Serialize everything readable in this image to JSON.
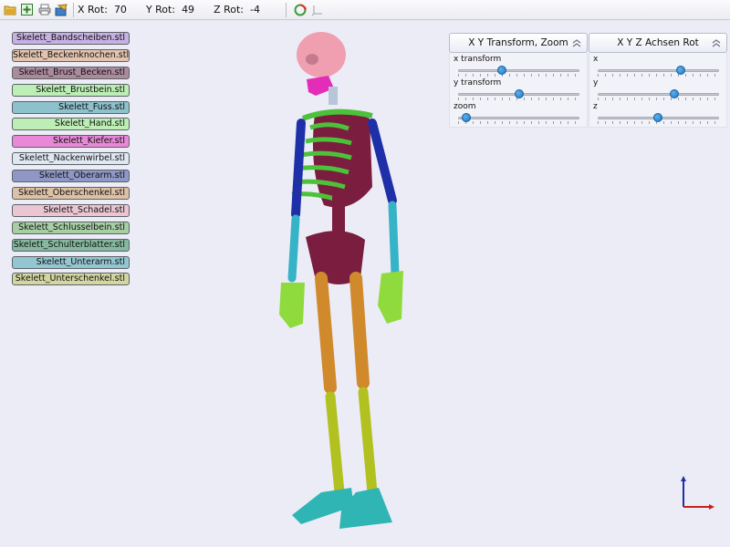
{
  "toolbar": {
    "icons": [
      "open-folder-icon",
      "add-model-icon",
      "print-icon",
      "export-icon",
      "reset-view-icon",
      "axis-icon"
    ],
    "x_rot_label": "X Rot:",
    "x_rot_value": "70",
    "y_rot_label": "Y Rot:",
    "y_rot_value": "49",
    "z_rot_label": "Z Rot:",
    "z_rot_value": "-4"
  },
  "files": [
    {
      "label": "Skelett_Bandscheiben.stl",
      "color": "#c7b0e2"
    },
    {
      "label": "Skelett_Beckenknochen.stl",
      "color": "#e3c3ae"
    },
    {
      "label": "Skelett_Brust_Becken.stl",
      "color": "#ab8a9c"
    },
    {
      "label": "Skelett_Brustbein.stl",
      "color": "#bdeeb5"
    },
    {
      "label": "Skelett_Fuss.stl",
      "color": "#8dc1cb"
    },
    {
      "label": "Skelett_Hand.stl",
      "color": "#bdeeb5"
    },
    {
      "label": "Skelett_Kiefer.stl",
      "color": "#e888d7"
    },
    {
      "label": "Skelett_Nackenwirbel.stl",
      "color": "#dfe7f1"
    },
    {
      "label": "Skelett_Oberarm.stl",
      "color": "#8e97c5"
    },
    {
      "label": "Skelett_Oberschenkel.stl",
      "color": "#ddc1a6"
    },
    {
      "label": "Skelett_Schadel.stl",
      "color": "#ecc5d3"
    },
    {
      "label": "Skelett_Schlusselbein.stl",
      "color": "#a7cfa4"
    },
    {
      "label": "Skelett_Schulterblatter.stl",
      "color": "#86b8a0"
    },
    {
      "label": "Skelett_Unterarm.stl",
      "color": "#94c6d1"
    },
    {
      "label": "Skelett_Unterschenkel.stl",
      "color": "#d2d6a1"
    }
  ],
  "panel_transform": {
    "title": "X Y Transform, Zoom",
    "sliders": [
      {
        "label": "x transform",
        "value": 0.36
      },
      {
        "label": "y transform",
        "value": 0.5
      },
      {
        "label": "zoom",
        "value": 0.07
      }
    ]
  },
  "panel_rotation": {
    "title": "X Y Z Achsen Rot",
    "sliders": [
      {
        "label": "x",
        "value": 0.68
      },
      {
        "label": "y",
        "value": 0.63
      },
      {
        "label": "z",
        "value": 0.49
      }
    ]
  },
  "axes": {
    "z_color": "#1f2fa8",
    "x_color": "#c8201c"
  }
}
